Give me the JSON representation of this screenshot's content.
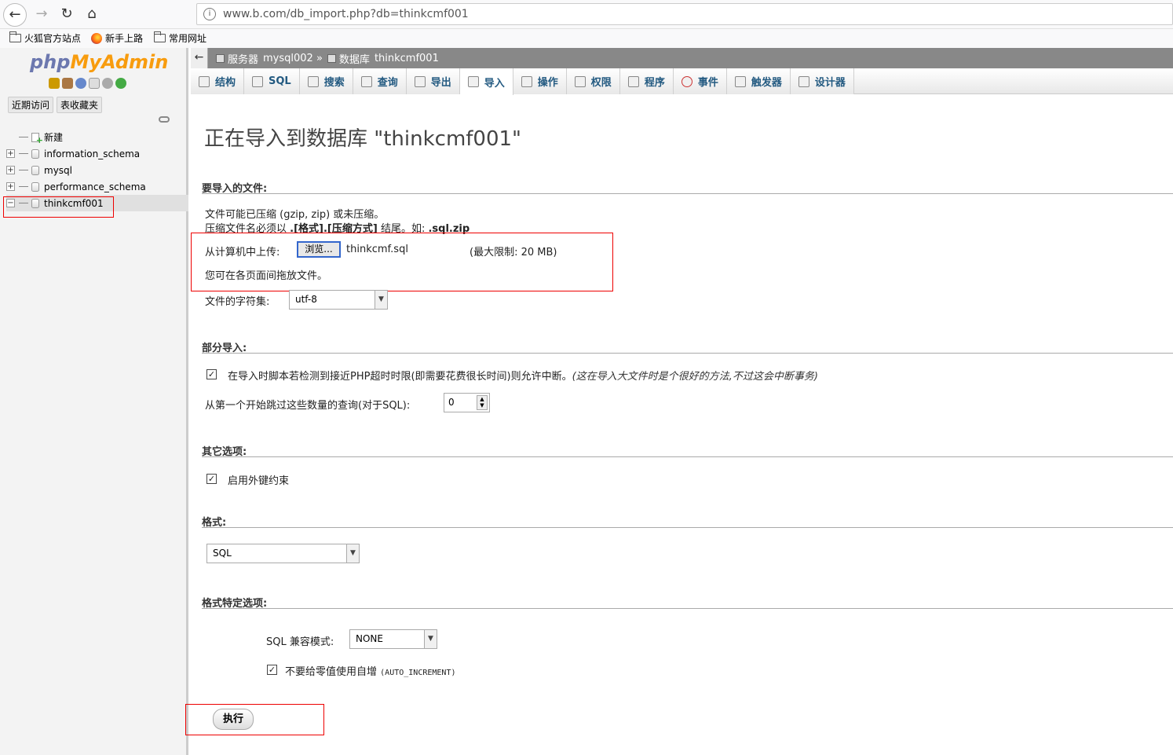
{
  "browser": {
    "url": "www.b.com/db_import.php?db=thinkcmf001",
    "bookmarks": [
      "火狐官方站点",
      "新手上路",
      "常用网址"
    ]
  },
  "sidebar": {
    "logo_part1": "php",
    "logo_part2": "MyAdmin",
    "tabs": [
      "近期访问",
      "表收藏夹"
    ],
    "new_label": "新建",
    "databases": [
      "information_schema",
      "mysql",
      "performance_schema",
      "thinkcmf001"
    ]
  },
  "breadcrumb": {
    "server_label": "服务器",
    "server_name": "mysql002 »",
    "db_label": "数据库",
    "db_name": "thinkcmf001"
  },
  "tabs": [
    {
      "label": "结构"
    },
    {
      "label": "SQL"
    },
    {
      "label": "搜索"
    },
    {
      "label": "查询"
    },
    {
      "label": "导出"
    },
    {
      "label": "导入"
    },
    {
      "label": "操作"
    },
    {
      "label": "权限"
    },
    {
      "label": "程序"
    },
    {
      "label": "事件"
    },
    {
      "label": "触发器"
    },
    {
      "label": "设计器"
    }
  ],
  "main": {
    "title": "正在导入到数据库 \"thinkcmf001\"",
    "file_section": "要导入的文件:",
    "compress_note": "文件可能已压缩 (gzip, zip) 或未压缩。",
    "compress_rule_prefix": "压缩文件名必须以",
    "compress_rule_format": ".[格式].[压缩方式]",
    "compress_rule_mid": "结尾。如:",
    "compress_rule_example": ".sql.zip",
    "upload_label": "从计算机中上传:",
    "browse_label": "浏览...",
    "file_name": "thinkcmf.sql",
    "max_limit": "(最大限制: 20 MB)",
    "drag_note": "您可在各页面间拖放文件。",
    "charset_label": "文件的字符集:",
    "charset_value": "utf-8",
    "partial_section": "部分导入:",
    "allow_interrupt": "在导入时脚本若检测到接近PHP超时时限(即需要花费很长时间)则允许中断。",
    "allow_interrupt_note": "(这在导入大文件时是个很好的方法,不过这会中断事务)",
    "skip_label": "从第一个开始跳过这些数量的查询(对于SQL):",
    "skip_value": "0",
    "other_section": "其它选项:",
    "fk_label": "启用外键约束",
    "format_section": "格式:",
    "format_value": "SQL",
    "format_opts_section": "格式特定选项:",
    "sql_compat_label": "SQL 兼容模式:",
    "sql_compat_value": "NONE",
    "no_auto_zero_label": "不要给零值使用自增",
    "no_auto_zero_code": "(AUTO_INCREMENT)",
    "go_label": "执行"
  }
}
